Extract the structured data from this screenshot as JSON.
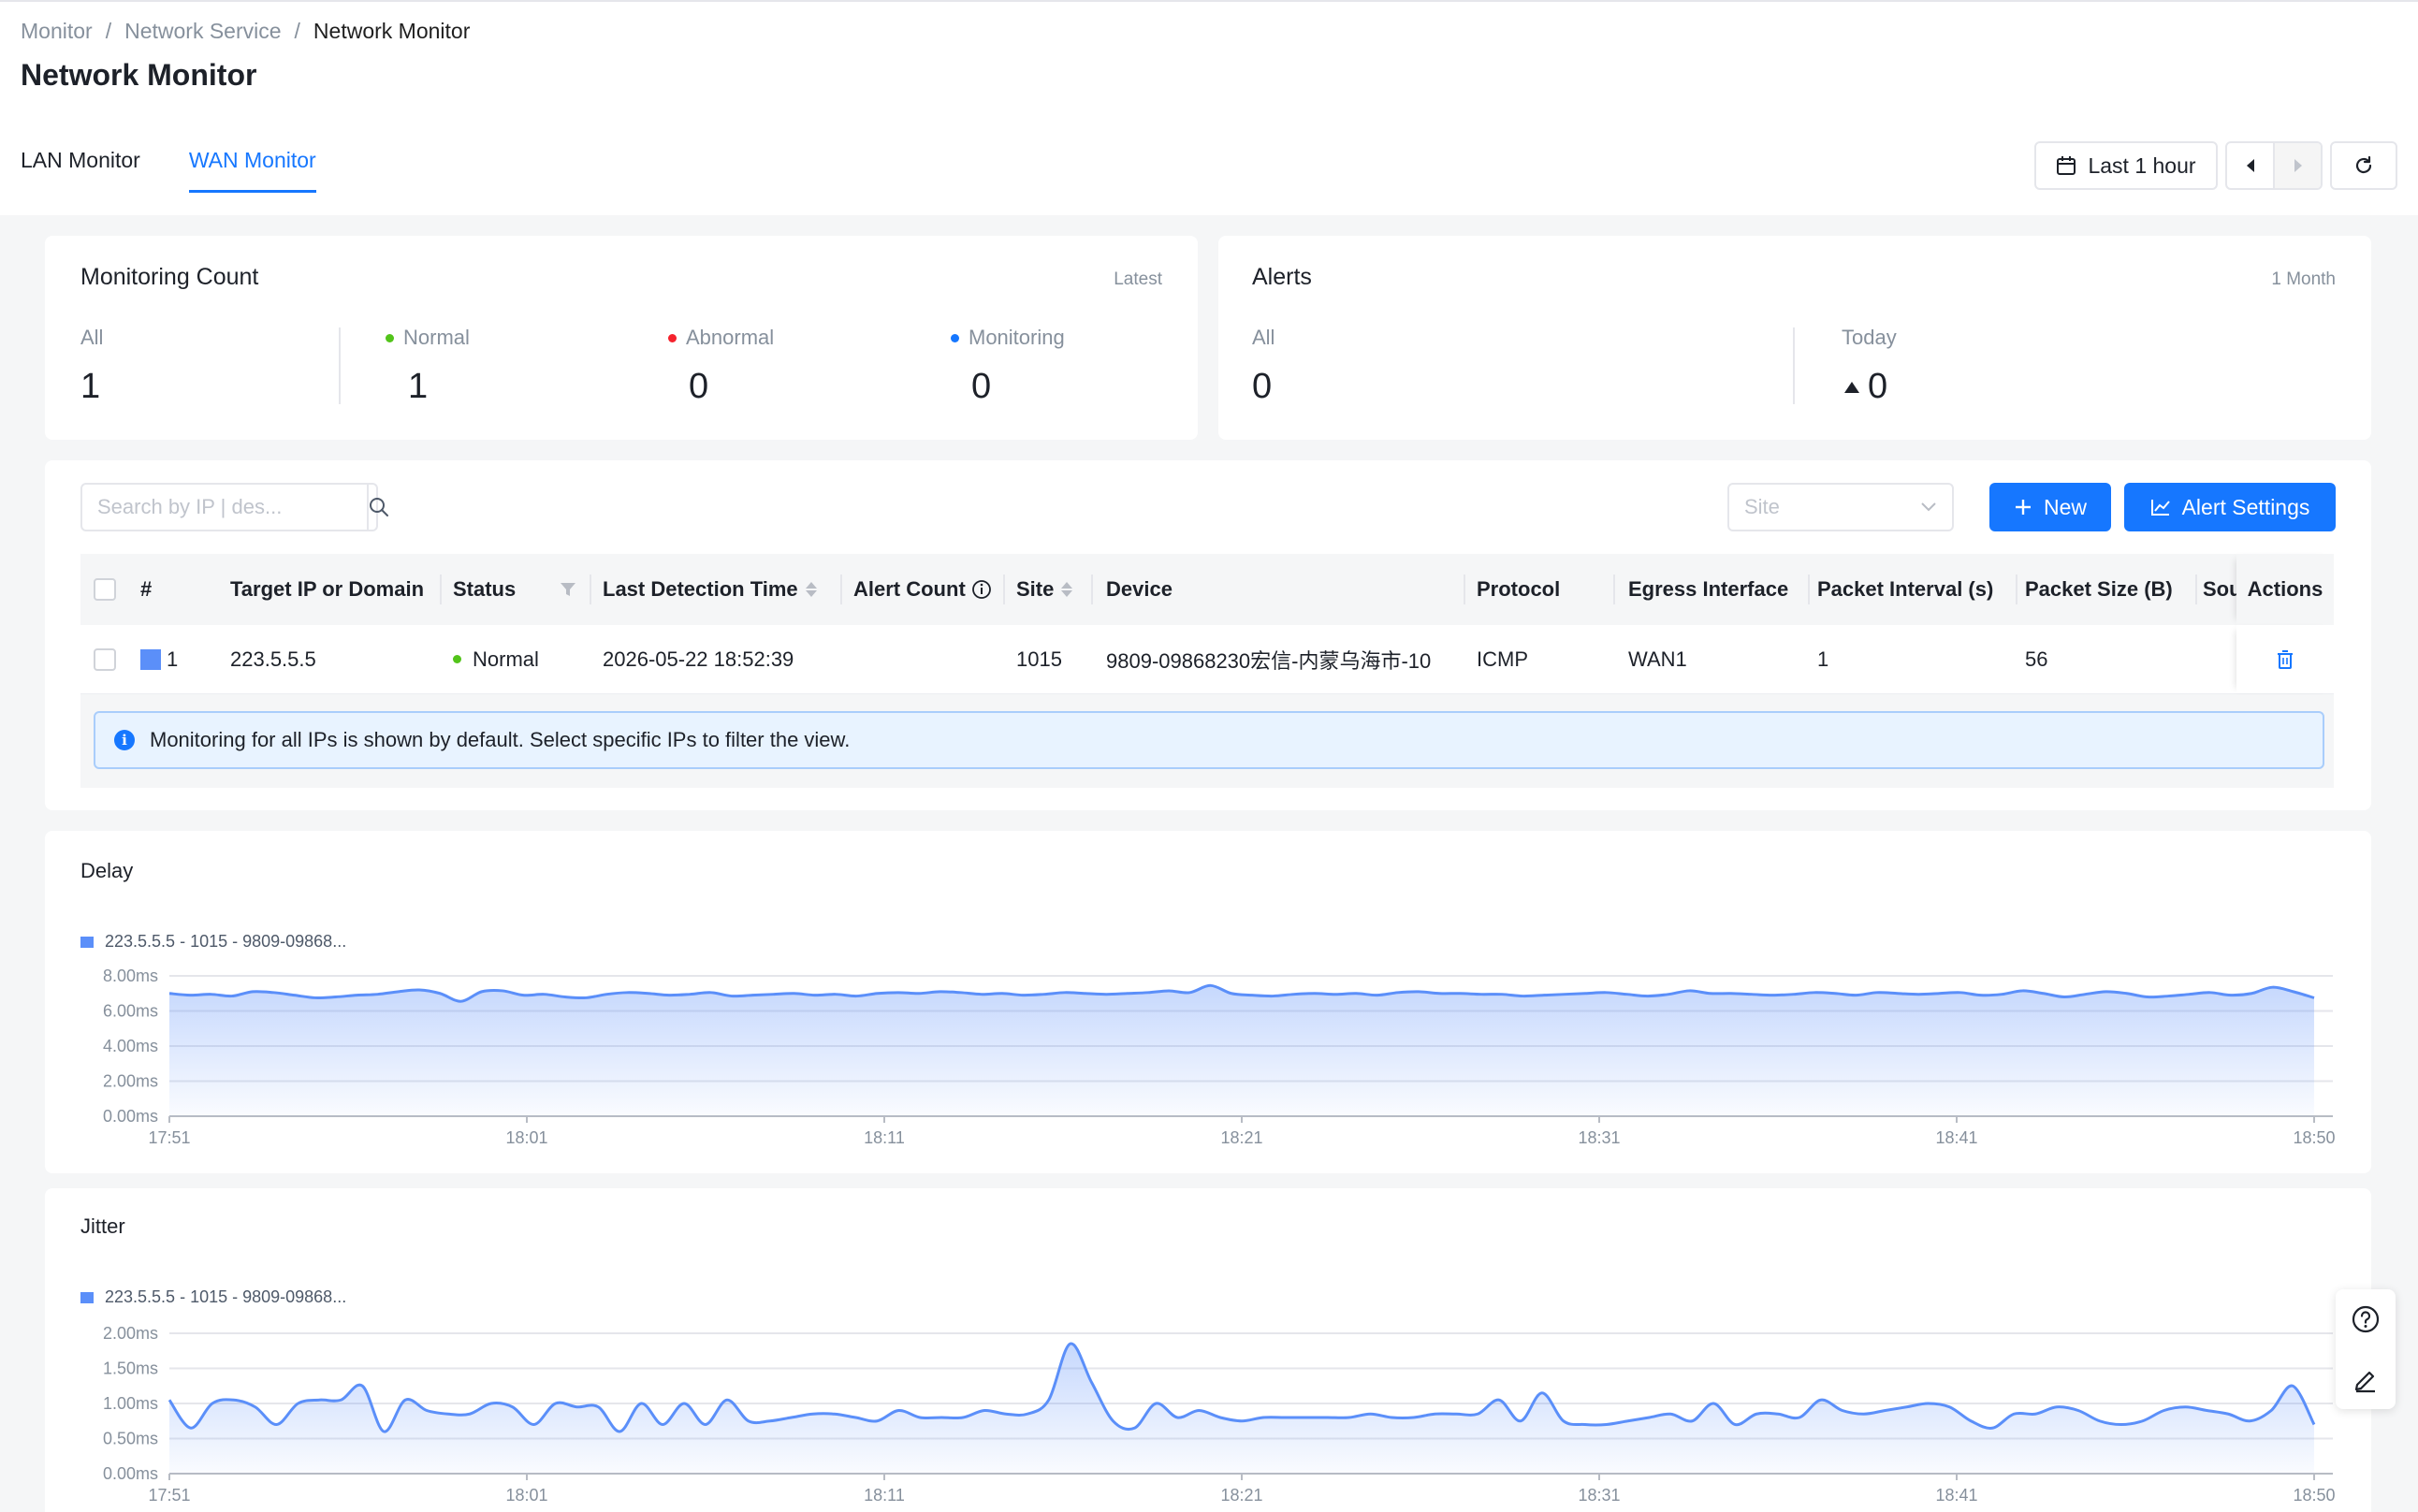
{
  "breadcrumb": [
    "Monitor",
    "Network Service",
    "Network Monitor"
  ],
  "page_title": "Network Monitor",
  "tabs": [
    {
      "label": "LAN Monitor",
      "active": false
    },
    {
      "label": "WAN Monitor",
      "active": true
    }
  ],
  "time_range": "Last 1 hour",
  "monitoring_count": {
    "title": "Monitoring Count",
    "tag": "Latest",
    "stats": [
      {
        "label": "All",
        "value": "1",
        "dot": null
      },
      {
        "label": "Normal",
        "value": "1",
        "dot": "#52c41a"
      },
      {
        "label": "Abnormal",
        "value": "0",
        "dot": "#f5222d"
      },
      {
        "label": "Monitoring",
        "value": "0",
        "dot": "#1677ff"
      }
    ]
  },
  "alerts": {
    "title": "Alerts",
    "tag": "1 Month",
    "stats": [
      {
        "label": "All",
        "value": "0"
      },
      {
        "label": "Today",
        "value": "0"
      }
    ]
  },
  "toolbar": {
    "search_placeholder": "Search by IP | des...",
    "site_placeholder": "Site",
    "new_label": "New",
    "alert_settings_label": "Alert Settings"
  },
  "table": {
    "columns": [
      "#",
      "Target IP or Domain",
      "Status",
      "Last Detection Time",
      "Alert Count",
      "Site",
      "Device",
      "Protocol",
      "Egress Interface",
      "Packet Interval (s)",
      "Packet Size (B)",
      "Sou",
      "Actions"
    ],
    "rows": [
      {
        "index": "1",
        "target": "223.5.5.5",
        "status": "Normal",
        "last_detection": "2026-05-22 18:52:39",
        "alert_count": "",
        "site": "1015",
        "device": "9809-09868230宏信-内蒙乌海市-10",
        "protocol": "ICMP",
        "egress": "WAN1",
        "interval": "1",
        "size": "56",
        "source": ""
      }
    ]
  },
  "info_message": "Monitoring for all IPs is shown by default. Select specific IPs to filter the view.",
  "colors": {
    "accent": "#1677ff",
    "series": "#5b8ff9",
    "normal": "#52c41a",
    "abnormal": "#f5222d"
  },
  "chart_data": [
    {
      "type": "area",
      "title": "Delay",
      "series": [
        {
          "name": "223.5.5.5 - 1015 - 9809-09868...",
          "values": [
            7.0,
            6.9,
            6.95,
            6.85,
            7.1,
            7.05,
            6.9,
            6.75,
            6.8,
            6.9,
            6.95,
            7.1,
            7.2,
            7.0,
            6.55,
            7.1,
            7.15,
            6.9,
            6.95,
            6.8,
            6.75,
            6.95,
            7.05,
            7.0,
            6.9,
            6.95,
            7.05,
            6.85,
            6.9,
            6.95,
            7.0,
            6.9,
            6.95,
            6.85,
            7.0,
            7.05,
            7.0,
            7.1,
            7.05,
            6.95,
            7.0,
            6.9,
            6.95,
            7.05,
            7.0,
            6.95,
            7.0,
            7.05,
            7.15,
            7.05,
            7.45,
            7.0,
            6.9,
            6.85,
            6.95,
            7.0,
            6.95,
            7.0,
            6.9,
            7.05,
            7.1,
            7.0,
            7.0,
            6.95,
            6.95,
            6.85,
            6.9,
            6.95,
            7.0,
            7.05,
            6.95,
            6.85,
            6.95,
            7.15,
            7.0,
            7.0,
            6.95,
            6.9,
            6.95,
            7.05,
            7.0,
            6.9,
            7.05,
            7.0,
            6.95,
            7.0,
            7.05,
            6.9,
            6.95,
            7.15,
            7.0,
            6.8,
            6.95,
            7.1,
            7.0,
            6.8,
            6.85,
            6.95,
            7.05,
            6.9,
            7.0,
            7.35,
            7.1,
            6.75
          ]
        }
      ],
      "y_ticks": [
        "0.00ms",
        "2.00ms",
        "4.00ms",
        "6.00ms",
        "8.00ms"
      ],
      "ylim": [
        0,
        8
      ],
      "x_ticks": [
        "17:51",
        "18:01",
        "18:11",
        "18:21",
        "18:31",
        "18:41",
        "18:50"
      ],
      "grid": true,
      "legend": "top-left"
    },
    {
      "type": "area",
      "title": "Jitter",
      "series": [
        {
          "name": "223.5.5.5 - 1015 - 9809-09868...",
          "values": [
            1.05,
            0.65,
            1.0,
            1.05,
            0.95,
            0.7,
            1.0,
            1.05,
            1.05,
            1.25,
            0.6,
            1.05,
            0.9,
            0.85,
            0.85,
            1.0,
            0.95,
            0.7,
            1.0,
            0.95,
            0.95,
            0.6,
            1.0,
            0.7,
            1.0,
            0.7,
            1.05,
            0.75,
            0.75,
            0.8,
            0.85,
            0.85,
            0.8,
            0.75,
            0.9,
            0.8,
            0.8,
            0.8,
            0.9,
            0.85,
            0.85,
            1.05,
            1.85,
            1.3,
            0.75,
            0.65,
            1.0,
            0.8,
            0.9,
            0.8,
            0.75,
            0.8,
            0.8,
            0.8,
            0.8,
            0.8,
            0.85,
            0.8,
            0.8,
            0.85,
            0.85,
            0.85,
            1.05,
            0.75,
            1.15,
            0.75,
            0.7,
            0.7,
            0.75,
            0.8,
            0.85,
            0.75,
            1.0,
            0.7,
            0.85,
            0.85,
            0.8,
            1.05,
            0.9,
            0.85,
            0.9,
            0.95,
            1.0,
            0.95,
            0.75,
            0.65,
            0.85,
            0.85,
            0.95,
            0.9,
            0.75,
            0.7,
            0.75,
            0.9,
            0.95,
            0.9,
            0.85,
            0.75,
            0.9,
            1.25,
            0.7
          ]
        }
      ],
      "y_ticks": [
        "0.00ms",
        "0.50ms",
        "1.00ms",
        "1.50ms",
        "2.00ms"
      ],
      "ylim": [
        0,
        2
      ],
      "x_ticks": [
        "17:51",
        "18:01",
        "18:11",
        "18:21",
        "18:31",
        "18:41",
        "18:50"
      ],
      "grid": true,
      "legend": "top-left"
    }
  ]
}
